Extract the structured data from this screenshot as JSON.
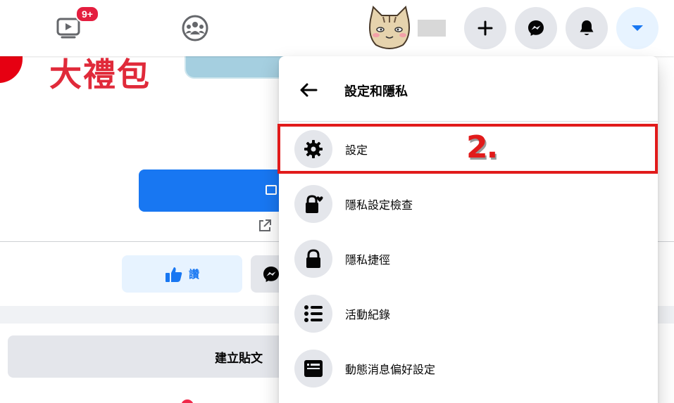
{
  "topbar": {
    "watch_badge": "9+"
  },
  "feed": {
    "promo_text": "大禮包",
    "like_label": "讚",
    "compose_label": "建立貼文"
  },
  "menu": {
    "title": "設定和隱私",
    "items": [
      {
        "label": "設定",
        "icon": "gear-icon"
      },
      {
        "label": "隱私設定檢查",
        "icon": "lock-heart-icon"
      },
      {
        "label": "隱私捷徑",
        "icon": "lock-icon"
      },
      {
        "label": "活動紀錄",
        "icon": "list-icon"
      },
      {
        "label": "動態消息偏好設定",
        "icon": "news-feed-icon"
      }
    ]
  },
  "annotation": {
    "step_label": "2."
  },
  "colors": {
    "accent": "#1877f2",
    "highlight": "#e11b1b",
    "badge": "#e41e3f",
    "icon_bg": "#e4e6eb"
  }
}
